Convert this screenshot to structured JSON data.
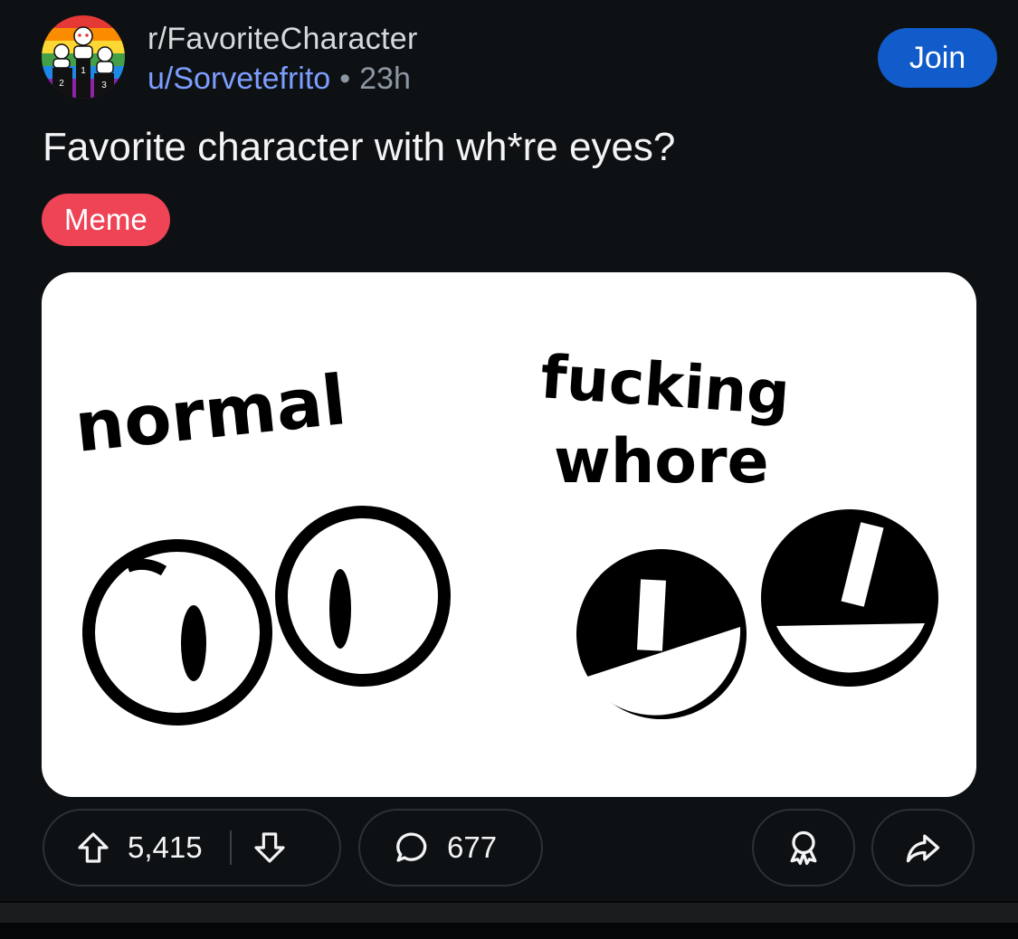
{
  "post": {
    "subreddit": "r/FavoriteCharacter",
    "author": "u/Sorvetefrito",
    "separator": "•",
    "age": "23h",
    "join_label": "Join",
    "title": "Favorite character with wh*re eyes?",
    "flair": "Meme",
    "flair_color": "#ee4456",
    "join_color": "#115bca",
    "username_color": "#7d9dff",
    "avatar": {
      "icon": "podium-snoo-avatar",
      "badges": [
        "2",
        "1",
        "3"
      ]
    },
    "image": {
      "label_left": "normal",
      "label_right_line1": "fucking",
      "label_right_line2": "whore"
    }
  },
  "actions": {
    "upvote_icon": "arrow-up-outline-icon",
    "upvotes": "5,415",
    "downvote_icon": "arrow-down-outline-icon",
    "comment_icon": "speech-bubble-icon",
    "comments": "677",
    "award_icon": "award-ribbon-icon",
    "share_icon": "share-arrow-icon"
  }
}
